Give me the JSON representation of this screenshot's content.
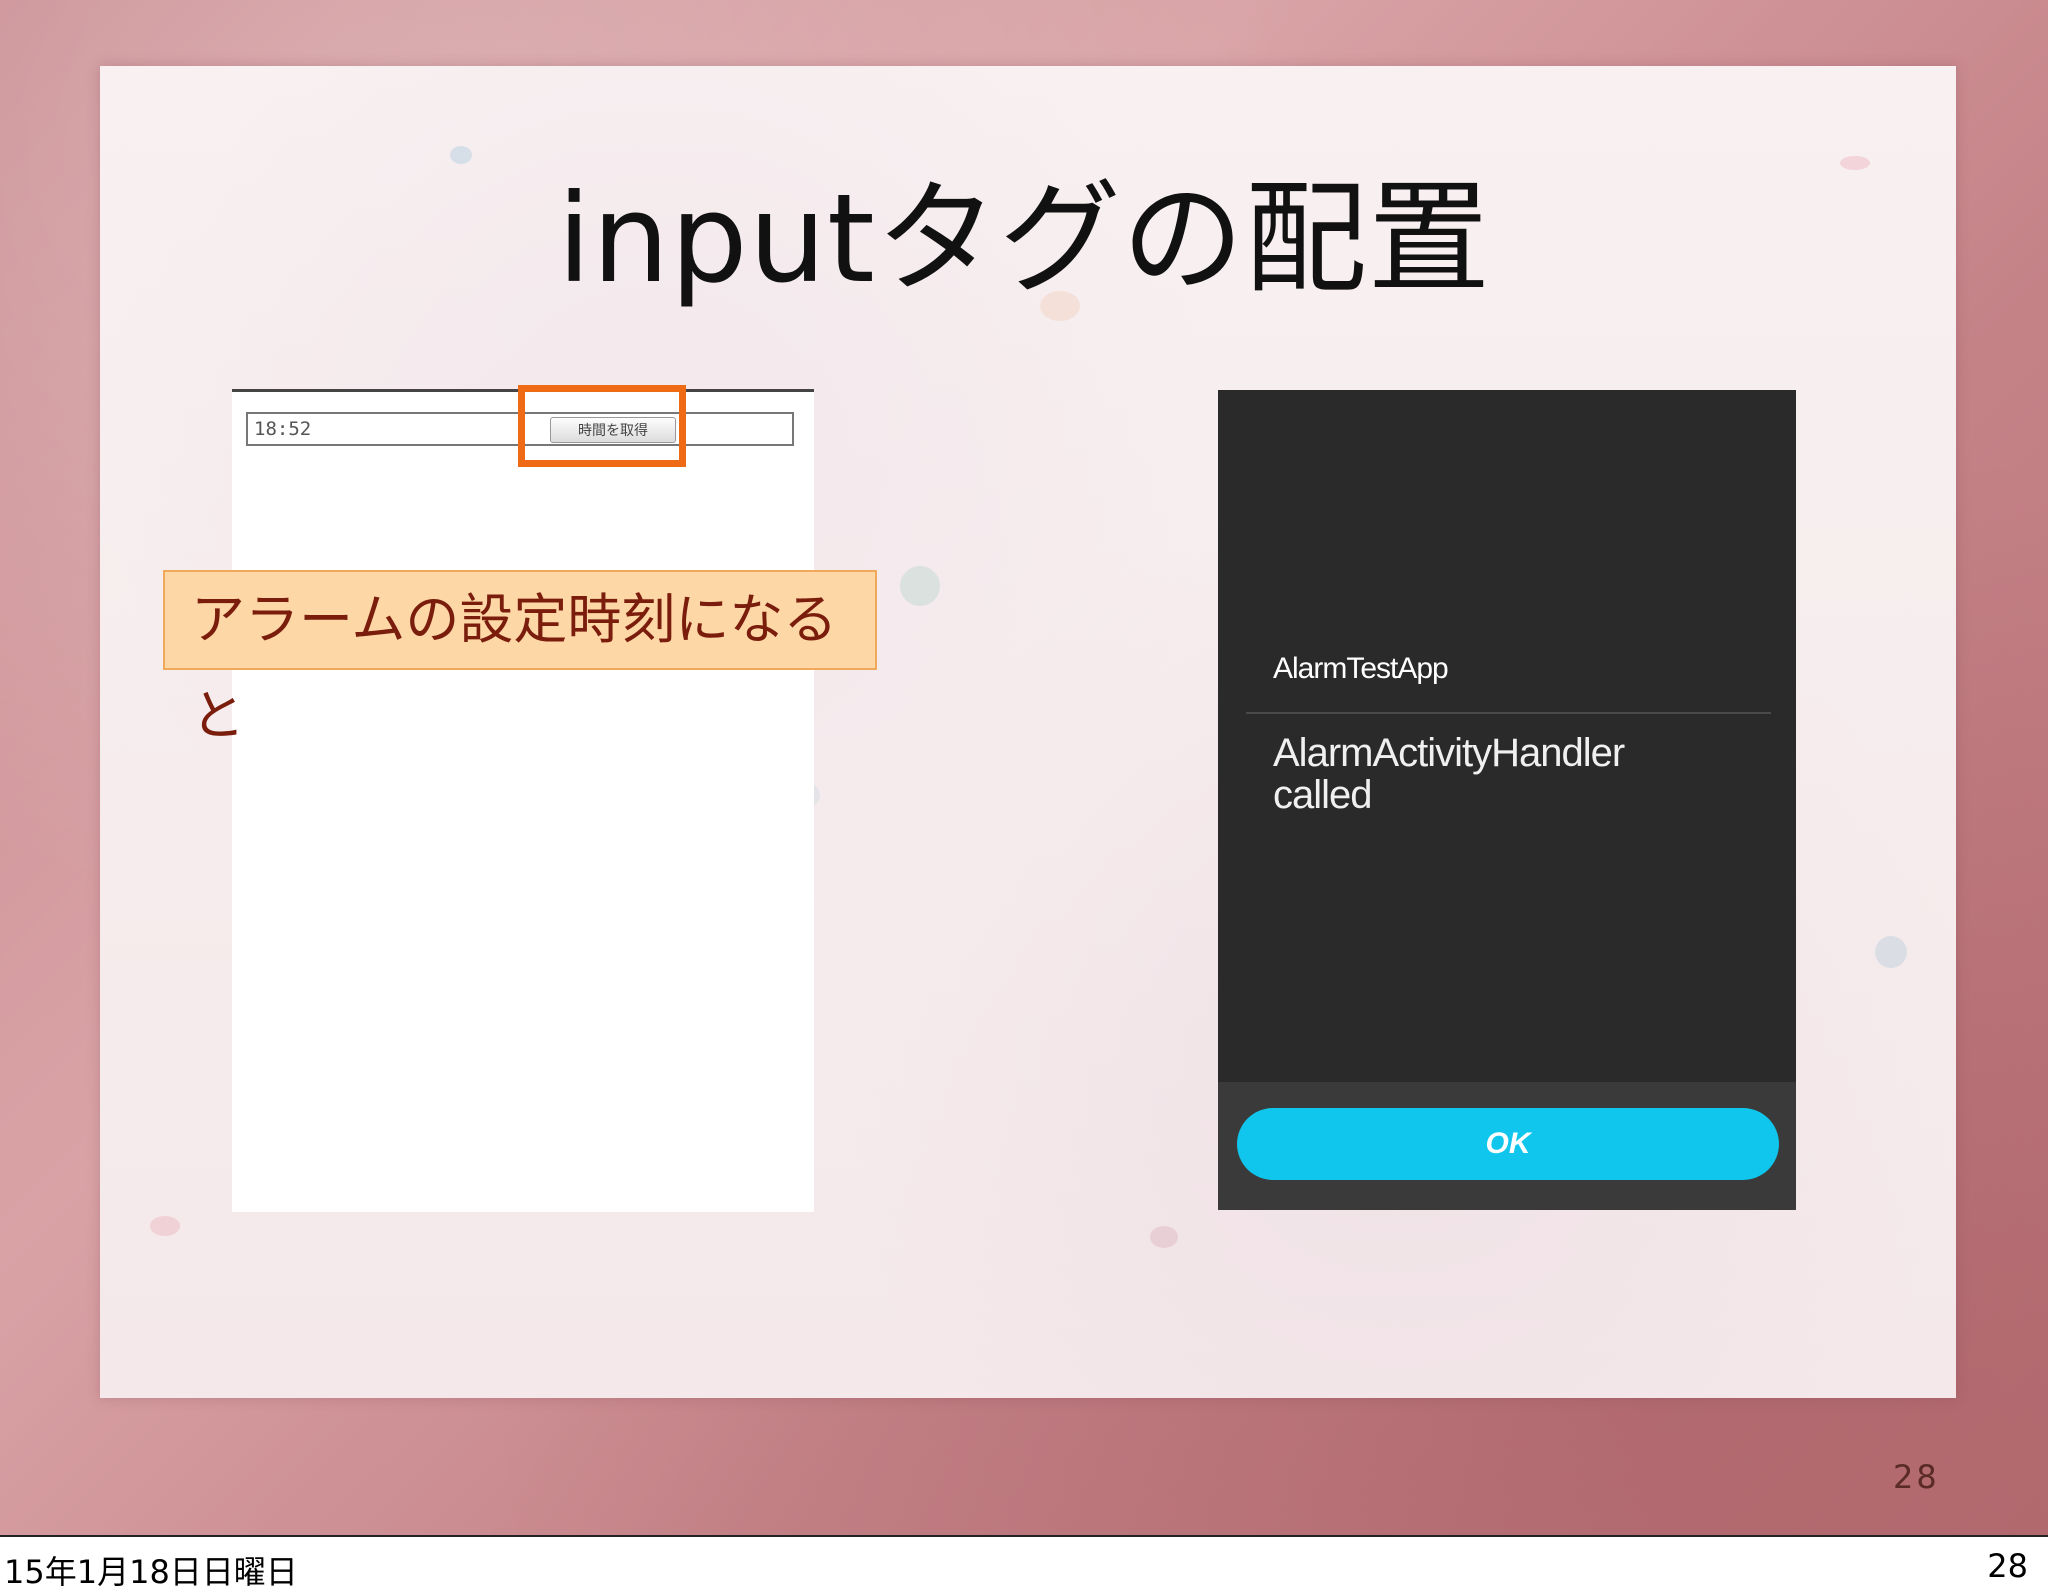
{
  "slide": {
    "title": "inputタグの配置",
    "page_number": "28"
  },
  "web_screenshot": {
    "time_value": "18:52",
    "button_label": "時間を取得"
  },
  "callout": {
    "text": "アラームの設定時刻になると"
  },
  "dialog": {
    "title": "AlarmTestApp",
    "message_line1": "AlarmActivityHandler",
    "message_line2": "called",
    "ok_label": "OK",
    "button_color": "#10c6ec",
    "background_color": "#2a2a2a"
  },
  "highlight_color": "#ee6a14",
  "footer": {
    "date": "15年1月18日日曜日",
    "page": "28"
  }
}
